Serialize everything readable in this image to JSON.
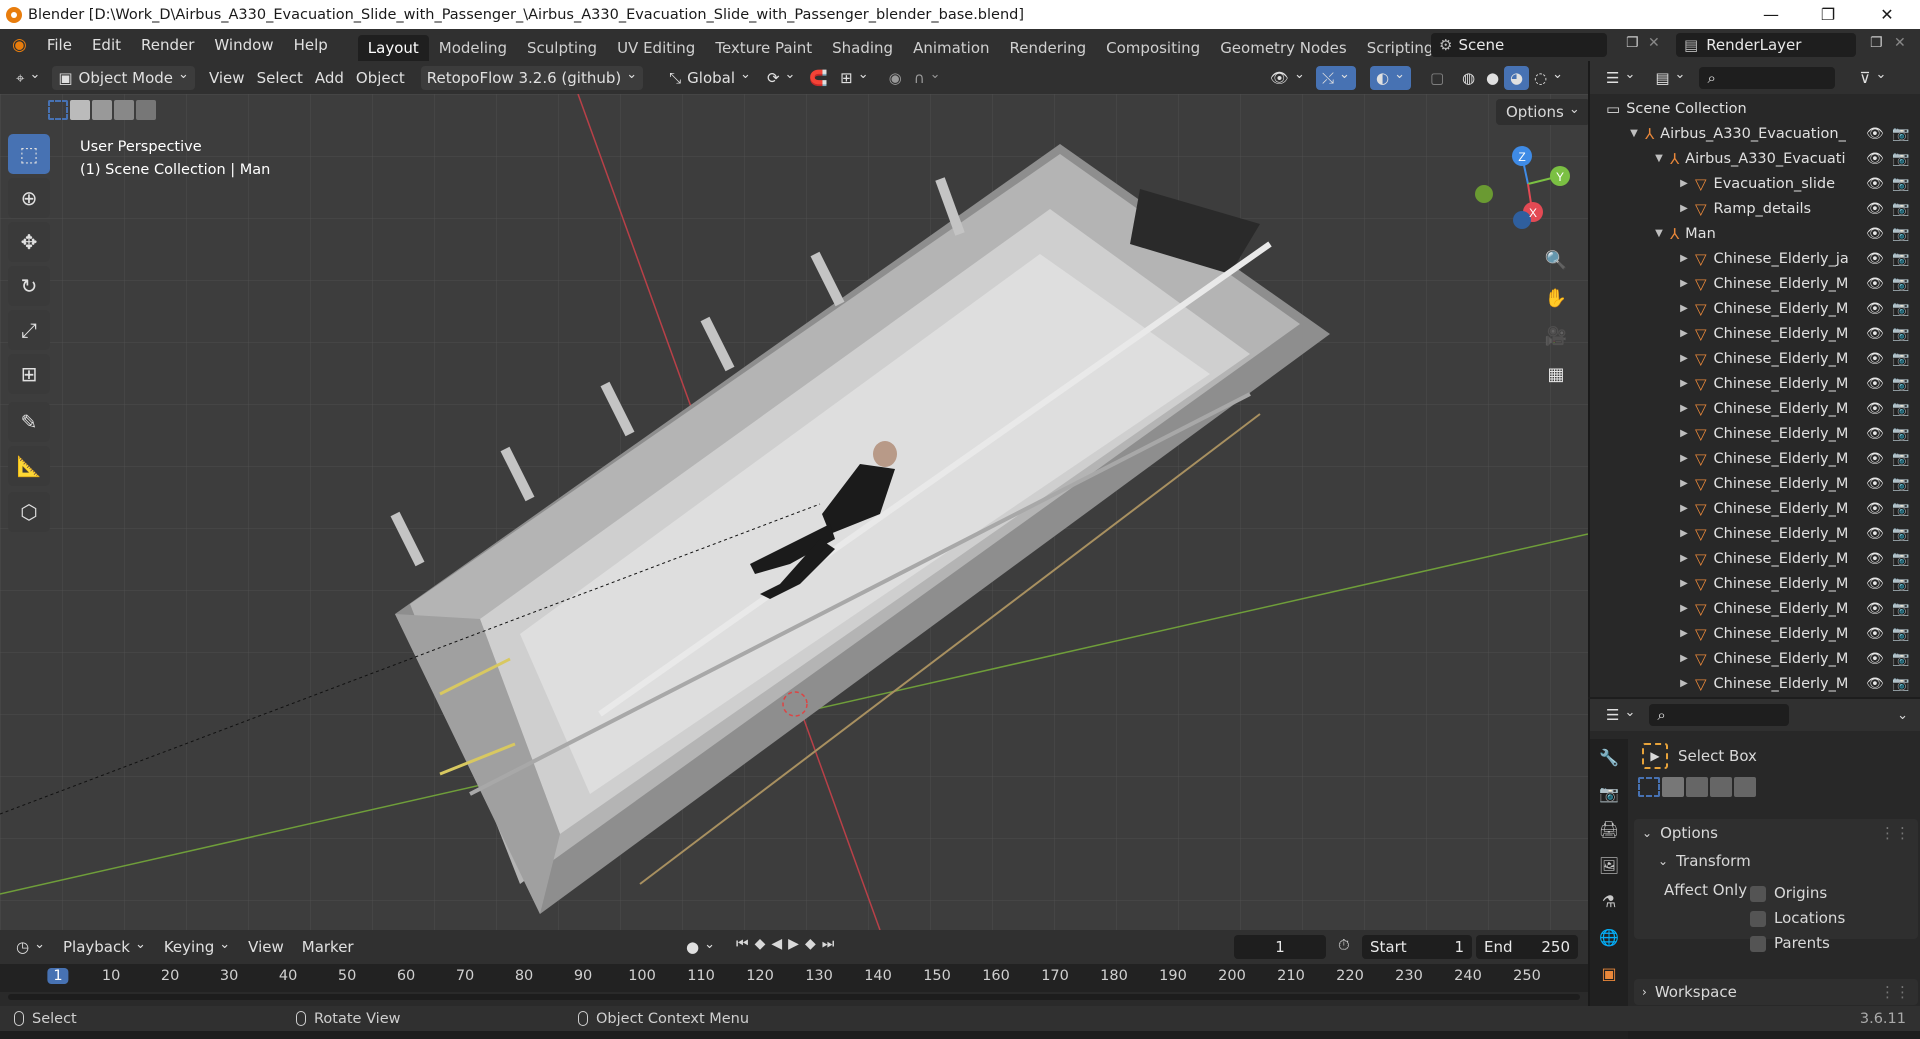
{
  "window": {
    "title": "Blender [D:\\Work_D\\Airbus_A330_Evacuation_Slide_with_Passenger_\\Airbus_A330_Evacuation_Slide_with_Passenger_blender_base.blend]",
    "min": "—",
    "max": "❐",
    "close": "✕"
  },
  "menu": [
    "File",
    "Edit",
    "Render",
    "Window",
    "Help"
  ],
  "workspaces": [
    "Layout",
    "Modeling",
    "Sculpting",
    "UV Editing",
    "Texture Paint",
    "Shading",
    "Animation",
    "Rendering",
    "Compositing",
    "Geometry Nodes",
    "Scripting"
  ],
  "active_workspace": "Layout",
  "add_workspace": "+",
  "scene": {
    "label": "Scene",
    "render_layer": "RenderLayer"
  },
  "viewport_header": {
    "mode": "Object Mode",
    "menus": [
      "View",
      "Select",
      "Add",
      "Object"
    ],
    "addon": "RetopoFlow 3.2.6 (github)",
    "orientation": "Global"
  },
  "viewport": {
    "perspective": "User Perspective",
    "collection": "(1) Scene Collection | Man",
    "options": "Options",
    "axes": {
      "z": "Z",
      "y": "Y",
      "x": "X"
    }
  },
  "outliner": {
    "root": "Scene Collection",
    "items": [
      {
        "label": "Airbus_A330_Evacuation_",
        "level": 1,
        "type": "empty",
        "open": true
      },
      {
        "label": "Airbus_A330_Evacuati",
        "level": 2,
        "type": "empty",
        "open": true
      },
      {
        "label": "Evacuation_slide",
        "level": 3,
        "type": "mesh",
        "open": false
      },
      {
        "label": "Ramp_details",
        "level": 3,
        "type": "mesh",
        "open": false
      },
      {
        "label": "Man",
        "level": 2,
        "type": "empty",
        "open": true
      },
      {
        "label": "Chinese_Elderly_ja",
        "level": 3,
        "type": "mesh",
        "open": false
      },
      {
        "label": "Chinese_Elderly_M",
        "level": 3,
        "type": "mesh",
        "open": false
      },
      {
        "label": "Chinese_Elderly_M",
        "level": 3,
        "type": "mesh",
        "open": false
      },
      {
        "label": "Chinese_Elderly_M",
        "level": 3,
        "type": "mesh",
        "open": false
      },
      {
        "label": "Chinese_Elderly_M",
        "level": 3,
        "type": "mesh",
        "open": false
      },
      {
        "label": "Chinese_Elderly_M",
        "level": 3,
        "type": "mesh",
        "open": false
      },
      {
        "label": "Chinese_Elderly_M",
        "level": 3,
        "type": "mesh",
        "open": false
      },
      {
        "label": "Chinese_Elderly_M",
        "level": 3,
        "type": "mesh",
        "open": false
      },
      {
        "label": "Chinese_Elderly_M",
        "level": 3,
        "type": "mesh",
        "open": false
      },
      {
        "label": "Chinese_Elderly_M",
        "level": 3,
        "type": "mesh",
        "open": false
      },
      {
        "label": "Chinese_Elderly_M",
        "level": 3,
        "type": "mesh",
        "open": false
      },
      {
        "label": "Chinese_Elderly_M",
        "level": 3,
        "type": "mesh",
        "open": false
      },
      {
        "label": "Chinese_Elderly_M",
        "level": 3,
        "type": "mesh",
        "open": false
      },
      {
        "label": "Chinese_Elderly_M",
        "level": 3,
        "type": "mesh",
        "open": false
      },
      {
        "label": "Chinese_Elderly_M",
        "level": 3,
        "type": "mesh",
        "open": false
      },
      {
        "label": "Chinese_Elderly_M",
        "level": 3,
        "type": "mesh",
        "open": false
      },
      {
        "label": "Chinese_Elderly_M",
        "level": 3,
        "type": "mesh",
        "open": false
      },
      {
        "label": "Chinese_Elderly_M",
        "level": 3,
        "type": "mesh",
        "open": false
      }
    ]
  },
  "properties": {
    "tool_name": "Select Box",
    "options_label": "Options",
    "transform_label": "Transform",
    "affect_only": "Affect Only",
    "checks": [
      "Origins",
      "Locations",
      "Parents"
    ],
    "workspace_label": "Workspace"
  },
  "timeline": {
    "menus": [
      "Playback",
      "Keying",
      "View",
      "Marker"
    ],
    "current_frame": "1",
    "start_label": "Start",
    "start": "1",
    "end_label": "End",
    "end": "250",
    "ticks": [
      "1",
      "10",
      "20",
      "30",
      "40",
      "50",
      "60",
      "70",
      "80",
      "90",
      "100",
      "110",
      "120",
      "130",
      "140",
      "150",
      "160",
      "170",
      "180",
      "190",
      "200",
      "210",
      "220",
      "230",
      "240",
      "250"
    ]
  },
  "statusbar": {
    "select": "Select",
    "rotate": "Rotate View",
    "context": "Object Context Menu",
    "version": "3.6.11"
  },
  "colors": {
    "accent": "#4772b3",
    "orange": "#e8873a",
    "x_axis": "#e34a54",
    "y_axis": "#7bc043",
    "z_axis": "#3f8be6"
  }
}
